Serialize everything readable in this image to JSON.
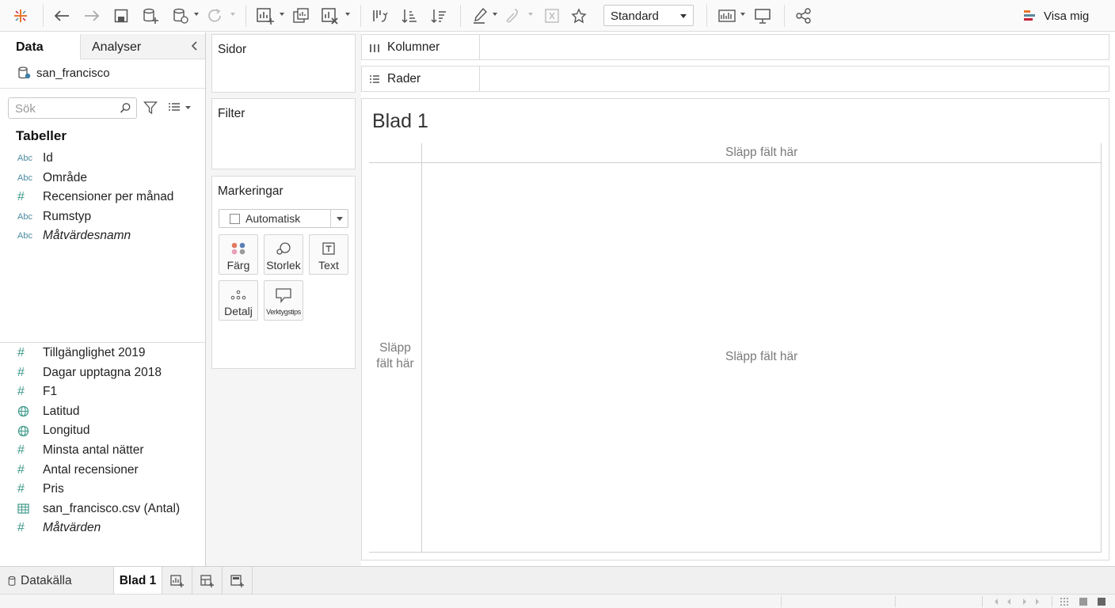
{
  "toolbar": {
    "layout_dropdown": "Standard",
    "show_me": "Visa mig"
  },
  "data_pane": {
    "tab_data": "Data",
    "tab_analytics": "Analyser",
    "datasource": "san_francisco",
    "search_placeholder": "Sök",
    "tables_heading": "Tabeller",
    "dimensions": [
      {
        "label": "Id",
        "type": "Abc"
      },
      {
        "label": "Område",
        "type": "Abc"
      },
      {
        "label": "Recensioner per månad",
        "type": "#"
      },
      {
        "label": "Rumstyp",
        "type": "Abc"
      },
      {
        "label": "Måtvärdesnamn",
        "type": "Abc"
      }
    ],
    "measures": [
      {
        "label": "Tillgänglighet 2019",
        "type": "#"
      },
      {
        "label": "Dagar upptagna 2018",
        "type": "#"
      },
      {
        "label": "F1",
        "type": "#"
      },
      {
        "label": "Latitud",
        "type": "globe"
      },
      {
        "label": "Longitud",
        "type": "globe"
      },
      {
        "label": "Minsta antal nätter",
        "type": "#"
      },
      {
        "label": "Antal recensioner",
        "type": "#"
      },
      {
        "label": "Pris",
        "type": "#"
      },
      {
        "label": "san_francisco.csv (Antal)",
        "type": "table"
      },
      {
        "label": "Måtvärden",
        "type": "#"
      }
    ]
  },
  "cards": {
    "pages": "Sidor",
    "filters": "Filter",
    "marks": "Markeringar",
    "marks_type": "Automatisk",
    "mark_buttons": {
      "color": "Färg",
      "size": "Storlek",
      "text": "Text",
      "detail": "Detalj",
      "tooltip": "Verktygstips"
    }
  },
  "shelves": {
    "columns": "Kolumner",
    "rows": "Rader"
  },
  "view": {
    "sheet_title": "Blad 1",
    "drop_top": "Släpp fält här",
    "drop_center": "Släpp fält här",
    "drop_left": "Släpp fält här"
  },
  "sheet_tabs": {
    "datasource": "Datakälla",
    "active_sheet": "Blad 1"
  },
  "colors": {
    "accent_teal": "#3f9a8a",
    "toolbar_bg": "#fafafa",
    "panel_bg": "#f5f5f5"
  }
}
